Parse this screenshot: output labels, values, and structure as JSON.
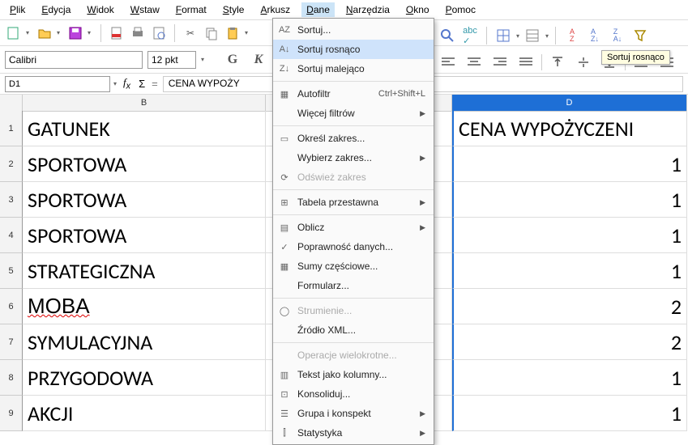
{
  "menubar": [
    "Plik",
    "Edycja",
    "Widok",
    "Wstaw",
    "Format",
    "Style",
    "Arkusz",
    "Dane",
    "Narzędzia",
    "Okno",
    "Pomoc"
  ],
  "activeMenu": "Dane",
  "font": {
    "name": "Calibri",
    "size": "12 pkt"
  },
  "bold_glyph": "G",
  "italic_glyph": "K",
  "cellref": "D1",
  "formula": "CENA WYPOŻY",
  "columns": [
    "",
    "B",
    "",
    "D"
  ],
  "selected_col_index": 3,
  "rows": [
    {
      "n": "1",
      "b": "GATUNEK",
      "c": "",
      "d": "CENA WYPOŻYCZENI"
    },
    {
      "n": "2",
      "b": "SPORTOWA",
      "c": "",
      "d": "1"
    },
    {
      "n": "3",
      "b": "SPORTOWA",
      "c": "",
      "d": "1"
    },
    {
      "n": "4",
      "b": "SPORTOWA",
      "c": "",
      "d": "1"
    },
    {
      "n": "5",
      "b": "STRATEGICZNA",
      "c": "",
      "d": "1"
    },
    {
      "n": "6",
      "b": "MOBA",
      "c": "",
      "d": "2",
      "wavy": true
    },
    {
      "n": "7",
      "b": "SYMULACYJNA",
      "c": "",
      "d": "2"
    },
    {
      "n": "8",
      "b": "PRZYGODOWA",
      "c": "",
      "d": "1"
    },
    {
      "n": "9",
      "b": "AKCJI",
      "c": "",
      "d": "1"
    }
  ],
  "dropdown": [
    {
      "ico": "AZ",
      "lbl": "Sortuj..."
    },
    {
      "ico": "A↓",
      "lbl": "Sortuj rosnąco",
      "hover": true
    },
    {
      "ico": "Z↓",
      "lbl": "Sortuj malejąco"
    },
    {
      "sep": true
    },
    {
      "ico": "▦",
      "lbl": "Autofiltr",
      "sc": "Ctrl+Shift+L"
    },
    {
      "lbl": "Więcej filtrów",
      "arrow": true
    },
    {
      "sep": true
    },
    {
      "ico": "▭",
      "lbl": "Określ zakres..."
    },
    {
      "lbl": "Wybierz zakres...",
      "arrow": true
    },
    {
      "ico": "⟳",
      "lbl": "Odśwież zakres",
      "disabled": true
    },
    {
      "sep": true
    },
    {
      "ico": "⊞",
      "lbl": "Tabela przestawna",
      "arrow": true
    },
    {
      "sep": true
    },
    {
      "ico": "▤",
      "lbl": "Oblicz",
      "arrow": true
    },
    {
      "ico": "✓",
      "lbl": "Poprawność danych..."
    },
    {
      "ico": "▦",
      "lbl": "Sumy częściowe..."
    },
    {
      "lbl": "Formularz..."
    },
    {
      "sep": true
    },
    {
      "ico": "◯",
      "lbl": "Strumienie...",
      "disabled": true
    },
    {
      "lbl": "Źródło XML..."
    },
    {
      "sep": true
    },
    {
      "lbl": "Operacje wielokrotne...",
      "disabled": true
    },
    {
      "ico": "▥",
      "lbl": "Tekst jako kolumny..."
    },
    {
      "ico": "⊡",
      "lbl": "Konsoliduj..."
    },
    {
      "ico": "☰",
      "lbl": "Grupa i konspekt",
      "arrow": true
    },
    {
      "ico": "⫿",
      "lbl": "Statystyka",
      "arrow": true
    }
  ],
  "tooltip": "Sortuj rosnąco",
  "toolbar_icons": [
    "new",
    "open",
    "save",
    "sep",
    "export",
    "print",
    "preview",
    "sep",
    "cut",
    "copy",
    "paste",
    "clone",
    "sep",
    "undo",
    "redo"
  ],
  "right_icons": [
    "find",
    "spell",
    "sep",
    "grid",
    "grid2",
    "sep",
    "sortcfg",
    "sortasc",
    "sortdesc",
    "filter"
  ],
  "align_icons": [
    "left",
    "center",
    "right",
    "justify",
    "sep",
    "top",
    "mid",
    "bot",
    "sep",
    "ind",
    "outd"
  ]
}
